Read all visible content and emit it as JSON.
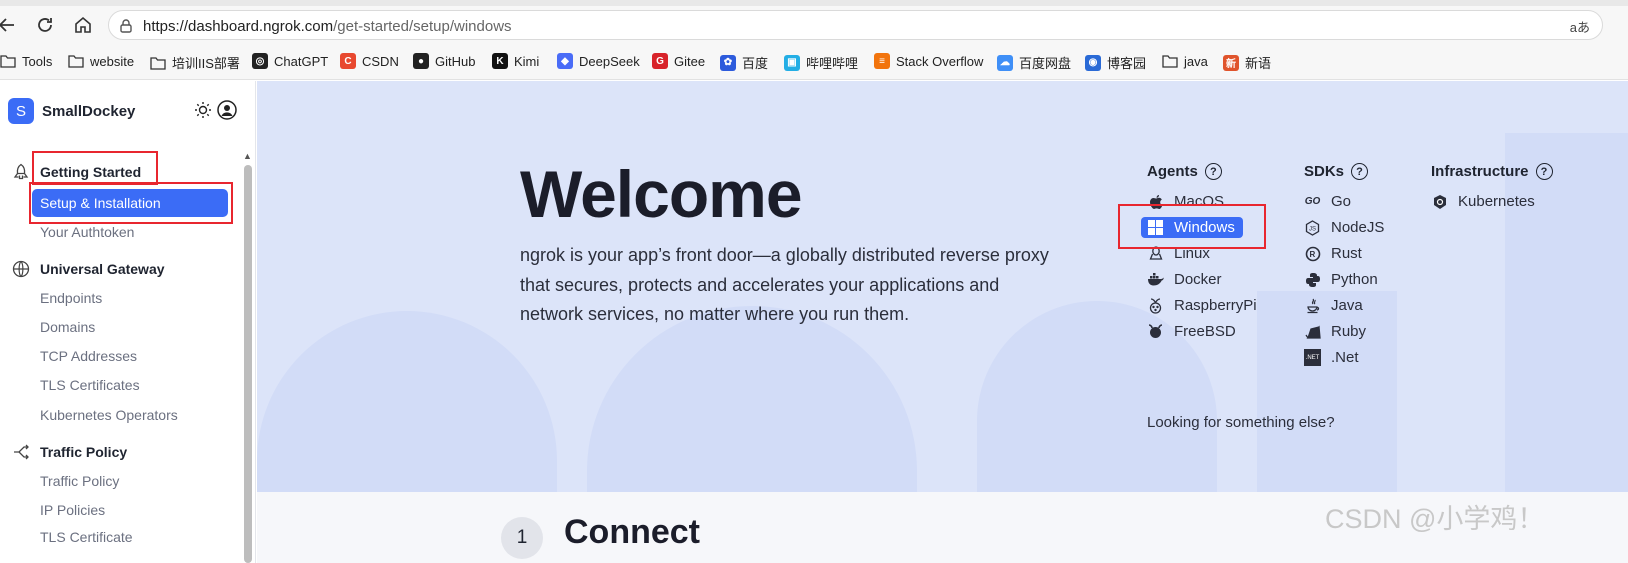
{
  "browser": {
    "url_host": "https://dashboard.ngrok.com",
    "url_path": "/get-started/setup/windows",
    "read_aloud": "aあ",
    "icons": [
      "back-icon",
      "reload-icon",
      "home-icon",
      "site-info-icon"
    ]
  },
  "bookmarks": [
    {
      "label": "Tools",
      "icon": "folder-icon"
    },
    {
      "label": "website",
      "icon": "folder-icon"
    },
    {
      "label": "培训IIS部署",
      "icon": "folder-icon"
    },
    {
      "label": "ChatGPT",
      "icon": "chatgpt-icon"
    },
    {
      "label": "CSDN",
      "icon": "csdn-icon"
    },
    {
      "label": "GitHub",
      "icon": "github-icon"
    },
    {
      "label": "Kimi",
      "icon": "kimi-icon"
    },
    {
      "label": "DeepSeek",
      "icon": "deepseek-icon"
    },
    {
      "label": "Gitee",
      "icon": "gitee-icon"
    },
    {
      "label": "百度",
      "icon": "baidu-icon"
    },
    {
      "label": "哔哩哔哩",
      "icon": "bilibili-icon"
    },
    {
      "label": "Stack Overflow",
      "icon": "stackoverflow-icon"
    },
    {
      "label": "百度网盘",
      "icon": "baidu-pan-icon"
    },
    {
      "label": "博客园",
      "icon": "cnblogs-icon"
    },
    {
      "label": "java",
      "icon": "folder-icon"
    },
    {
      "label": "新语",
      "icon": "xinyu-icon"
    }
  ],
  "sidebar": {
    "account_initial": "S",
    "account_name": "SmallDockey",
    "sections": [
      {
        "title": "Getting Started",
        "icon": "rocket-icon",
        "items": [
          "Setup & Installation",
          "Your Authtoken"
        ]
      },
      {
        "title": "Universal Gateway",
        "icon": "globe-icon",
        "items": [
          "Endpoints",
          "Domains",
          "TCP Addresses",
          "TLS Certificates",
          "Kubernetes Operators"
        ]
      },
      {
        "title": "Traffic Policy",
        "icon": "branch-icon",
        "items": [
          "Traffic Policy",
          "IP Policies",
          "TLS Certificate"
        ]
      }
    ],
    "active_item": "Setup & Installation"
  },
  "main": {
    "welcome": "Welcome",
    "intro": "ngrok is your app’s front door—a globally distributed reverse proxy that secures, protects and accelerates your applications and network services, no matter where you run them.",
    "agents": {
      "title": "Agents",
      "items": [
        "MacOS",
        "Windows",
        "Linux",
        "Docker",
        "RaspberryPi",
        "FreeBSD"
      ],
      "selected": "Windows"
    },
    "sdks": {
      "title": "SDKs",
      "items": [
        "Go",
        "NodeJS",
        "Rust",
        "Python",
        "Java",
        "Ruby",
        ".Net"
      ]
    },
    "infrastructure": {
      "title": "Infrastructure",
      "items": [
        "Kubernetes"
      ]
    },
    "looking": "Looking for something else?",
    "step_number": "1",
    "step_title": "Connect"
  },
  "watermark": "CSDN @小学鸡！",
  "colors": {
    "accent": "#3b6cf6",
    "annotation": "#e8262f",
    "hero_bg": "#dce4f9"
  }
}
